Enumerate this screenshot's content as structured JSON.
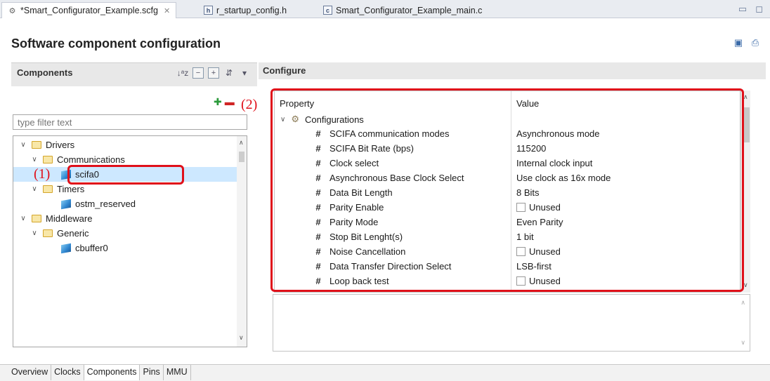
{
  "tabs": [
    {
      "label": "*Smart_Configurator_Example.scfg",
      "icon": "gear-icon",
      "active": true,
      "close": "✕"
    },
    {
      "label": "r_startup_config.h",
      "icon": "h-file-icon",
      "glyph": "h"
    },
    {
      "label": "Smart_Configurator_Example_main.c",
      "icon": "c-file-icon",
      "glyph": "c"
    }
  ],
  "window_controls": {
    "minimize": "▭",
    "maximize": "◻"
  },
  "header": {
    "title": "Software component configuration"
  },
  "components": {
    "title": "Components",
    "filter_placeholder": "type filter text",
    "tree": [
      {
        "label": "Drivers",
        "level": 0,
        "type": "folder",
        "expanded": true
      },
      {
        "label": "Communications",
        "level": 1,
        "type": "folder",
        "expanded": true
      },
      {
        "label": "scifa0",
        "level": 2,
        "type": "component",
        "selected": true
      },
      {
        "label": "Timers",
        "level": 1,
        "type": "folder",
        "expanded": true
      },
      {
        "label": "ostm_reserved",
        "level": 2,
        "type": "component"
      },
      {
        "label": "Middleware",
        "level": 0,
        "type": "folder",
        "expanded": true
      },
      {
        "label": "Generic",
        "level": 1,
        "type": "folder",
        "expanded": true
      },
      {
        "label": "cbuffer0",
        "level": 2,
        "type": "component"
      }
    ]
  },
  "configure": {
    "title": "Configure",
    "columns": {
      "property": "Property",
      "value": "Value"
    },
    "group": "Configurations",
    "rows": [
      {
        "property": "SCIFA communication modes",
        "value": "Asynchronous mode"
      },
      {
        "property": "SCIFA Bit Rate (bps)",
        "value": "115200"
      },
      {
        "property": "Clock select",
        "value": "Internal clock input"
      },
      {
        "property": "Asynchronous Base Clock Select",
        "value": "Use clock as 16x mode"
      },
      {
        "property": "Data Bit Length",
        "value": "8 Bits"
      },
      {
        "property": "Parity Enable",
        "value": "Unused",
        "checkbox": true
      },
      {
        "property": "Parity Mode",
        "value": "Even Parity"
      },
      {
        "property": "Stop Bit Lenght(s)",
        "value": "1 bit"
      },
      {
        "property": "Noise Cancellation",
        "value": "Unused",
        "checkbox": true
      },
      {
        "property": "Data Transfer Direction Select",
        "value": "LSB-first"
      },
      {
        "property": "Loop back test",
        "value": "Unused",
        "checkbox": true
      }
    ]
  },
  "bottom_tabs": [
    "Overview",
    "Clocks",
    "Components",
    "Pins",
    "MMU"
  ],
  "active_bottom_tab": "Components",
  "annotations": {
    "callout_1": "(1)",
    "callout_2": "(2)"
  },
  "colors": {
    "annotation": "#e0101a",
    "selection": "#cde8ff"
  }
}
